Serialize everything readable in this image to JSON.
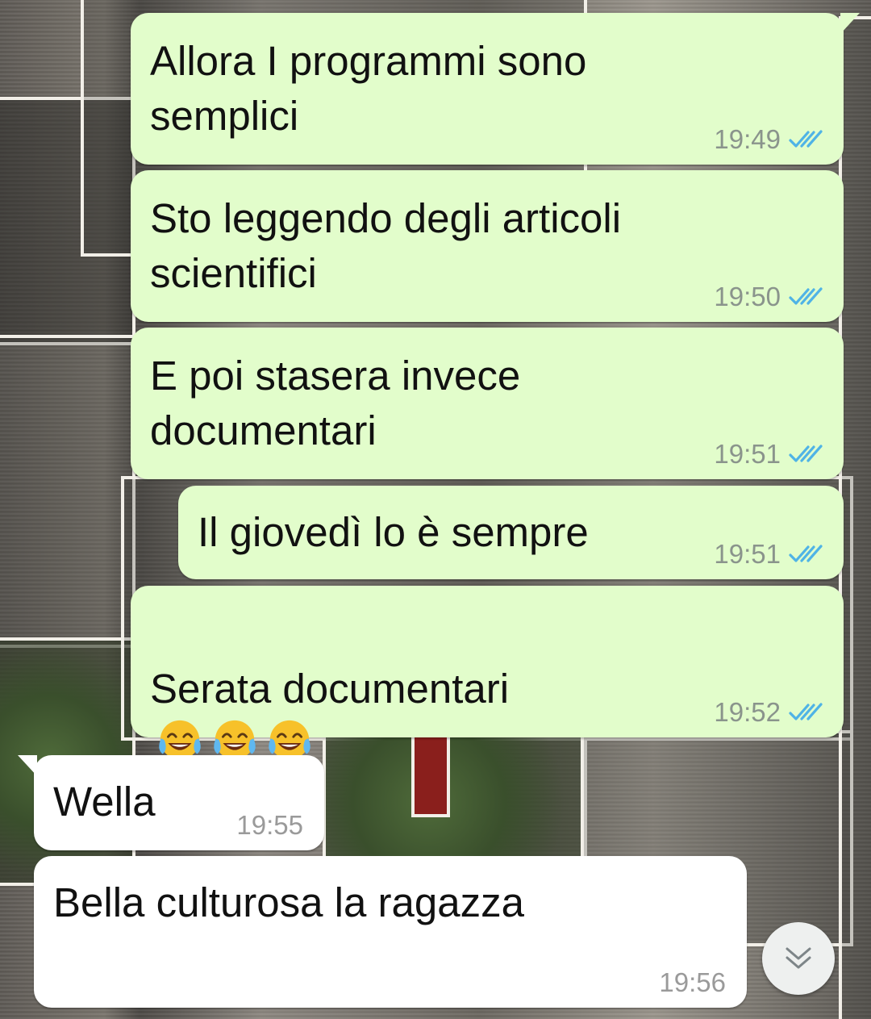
{
  "messages": [
    {
      "direction": "outgoing",
      "text": "Allora I programmi sono\nsemplici",
      "time": "19:49",
      "status": "read"
    },
    {
      "direction": "outgoing",
      "text": "Sto leggendo degli articoli\nscientifici",
      "time": "19:50",
      "status": "read"
    },
    {
      "direction": "outgoing",
      "text": "E poi stasera invece\ndocumentari",
      "time": "19:51",
      "status": "read"
    },
    {
      "direction": "outgoing",
      "text": "Il giovedì lo è sempre",
      "time": "19:51",
      "status": "read"
    },
    {
      "direction": "outgoing",
      "text": "Serata documentari",
      "emoji": [
        "tears-of-joy",
        "tears-of-joy",
        "tears-of-joy"
      ],
      "time": "19:52",
      "status": "read"
    },
    {
      "direction": "incoming",
      "text": "Wella",
      "time": "19:55"
    },
    {
      "direction": "incoming",
      "text": "Bella culturosa la ragazza",
      "time": "19:56"
    }
  ],
  "scroll_button": {
    "icon": "double-chevron-down-icon"
  },
  "colors": {
    "outgoing_bubble": "#e2fdcb",
    "incoming_bubble": "#ffffff",
    "read_ticks": "#4fb3e6",
    "timestamp": "#8a948c"
  }
}
